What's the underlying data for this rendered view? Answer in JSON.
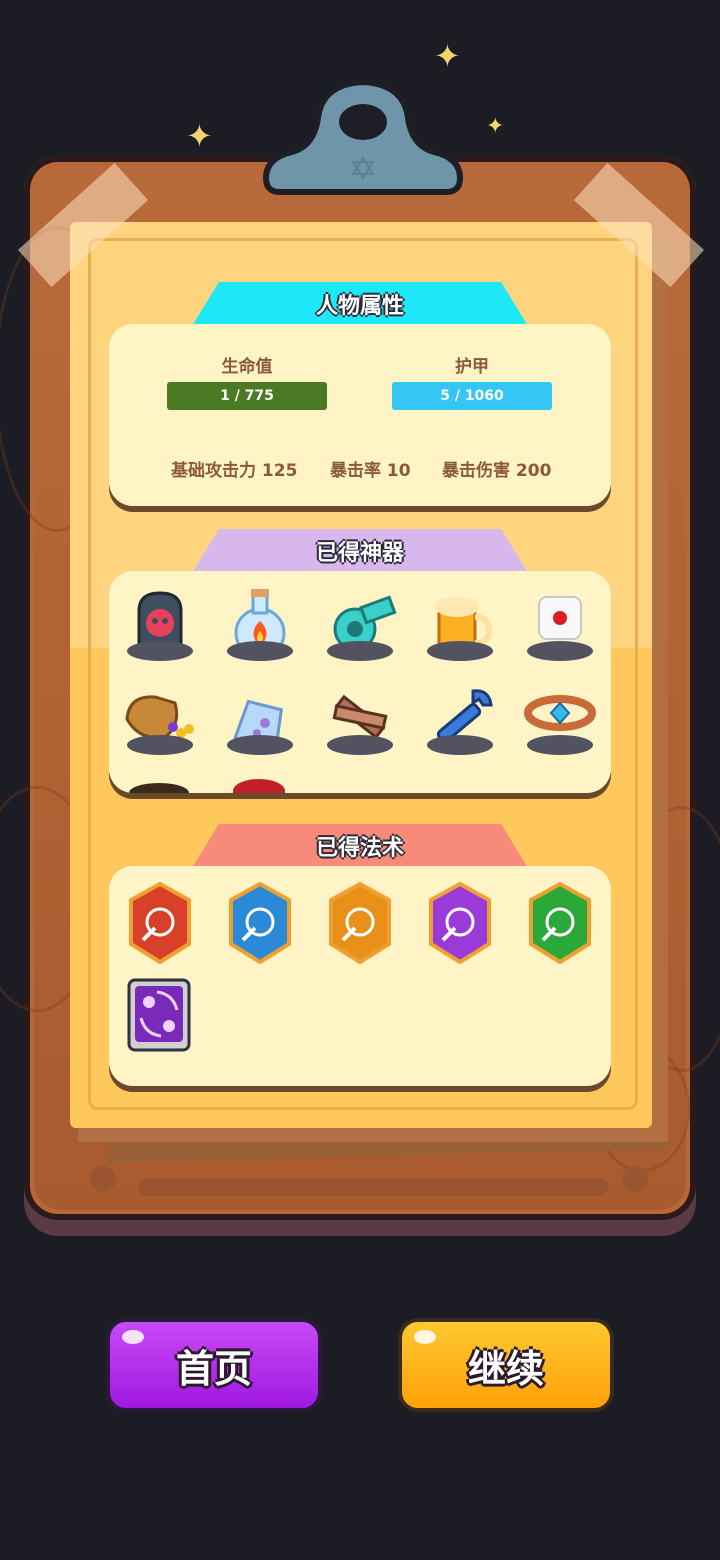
{
  "character_stats": {
    "section_title": "人物属性",
    "hp": {
      "label": "生命值",
      "value_text": "1 / 775",
      "color": "#4b7a24"
    },
    "armor": {
      "label": "护甲",
      "value_text": "5 / 1060",
      "color": "#34c6f4"
    },
    "base_attack": "基础攻击力 125",
    "crit_rate": "暴击率 10",
    "crit_damage": "暴击伤害 200"
  },
  "artifacts": {
    "section_title": "已得神器",
    "tab_color": "#d8b8ec",
    "items": [
      "skull-tombstone-icon",
      "fire-potion-icon",
      "whistle-icon",
      "beer-mug-icon",
      "dice-icon",
      "treasure-sack-icon",
      "charm-bag-icon",
      "wooden-planks-icon",
      "wrench-icon",
      "gem-bracelet-icon"
    ]
  },
  "spells": {
    "section_title": "已得法术",
    "tab_color": "#f78a78",
    "items": [
      {
        "icon": "fire-spell-icon",
        "color": "#d8402a"
      },
      {
        "icon": "ice-spell-icon",
        "color": "#2a8ad8"
      },
      {
        "icon": "light-spell-icon",
        "color": "#e8901a"
      },
      {
        "icon": "arcane-spell-icon",
        "color": "#9a3ad8"
      },
      {
        "icon": "nature-spell-icon",
        "color": "#2aa83a"
      },
      {
        "icon": "vortex-spell-icon",
        "color": "#7a2ab8"
      }
    ]
  },
  "buttons": {
    "home": {
      "label": "首页",
      "color": "#b02af0"
    },
    "continue": {
      "label": "继续",
      "color": "#ffb010"
    }
  },
  "stats_tab_color": "#1ee8f8"
}
